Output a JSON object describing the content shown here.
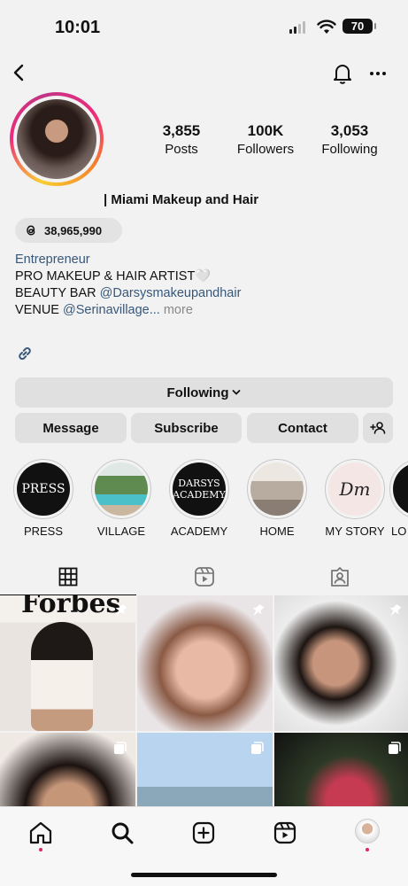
{
  "status": {
    "time": "10:01",
    "battery": "70"
  },
  "profile": {
    "name": "| Miami Makeup and Hair",
    "threads_count": "38,965,990",
    "stats": [
      {
        "num": "3,855",
        "label": "Posts"
      },
      {
        "num": "100K",
        "label": "Followers"
      },
      {
        "num": "3,053",
        "label": "Following"
      }
    ],
    "bio": {
      "category": "Entrepreneur",
      "line1": "PRO MAKEUP & HAIR ARTIST🤍",
      "line2_prefix": "BEAUTY BAR ",
      "line2_mention": "@Darsysmakeupandhair",
      "line3_prefix": "VENUE ",
      "line3_mention": "@Serinavillage...",
      "more": " more"
    }
  },
  "buttons": {
    "following": "Following",
    "message": "Message",
    "subscribe": "Subscribe",
    "contact": "Contact"
  },
  "highlights": [
    {
      "label": "PRESS",
      "cover_text": "PRESS"
    },
    {
      "label": "VILLAGE",
      "cover_text": ""
    },
    {
      "label": "ACADEMY",
      "cover_text": "DARSYS ACADEMY"
    },
    {
      "label": "HOME",
      "cover_text": ""
    },
    {
      "label": "MY STORY",
      "cover_text": "Dm"
    },
    {
      "label": "LO",
      "cover_text": ""
    }
  ],
  "grid": {
    "first_post_text": "Forbes"
  },
  "icons": {
    "back": "chevron-left-icon",
    "bell": "bell-icon",
    "more": "more-horizontal-icon",
    "threads": "threads-icon",
    "link": "link-icon",
    "add_user": "add-user-icon",
    "grid_tab": "grid-icon",
    "reels_tab": "reels-icon",
    "tagged_tab": "tagged-icon",
    "pinned": "pin-icon",
    "carousel": "carousel-icon",
    "home": "home-icon",
    "search": "search-icon",
    "create": "plus-square-icon",
    "reels": "reels-icon",
    "profile": "profile-avatar-icon"
  },
  "colors": {
    "accent_link": "#37577a",
    "notification_dot": "#e0245e"
  }
}
